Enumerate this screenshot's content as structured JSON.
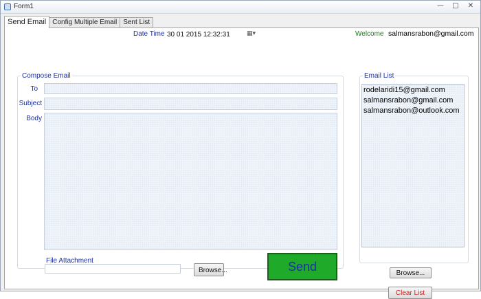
{
  "window": {
    "title": "Form1",
    "controls": [
      "—",
      "□",
      "✕"
    ]
  },
  "tabs": [
    {
      "label": "Send Email",
      "active": true
    },
    {
      "label": "Config Multiple Email",
      "active": false
    },
    {
      "label": "Sent List",
      "active": false
    }
  ],
  "header": {
    "datetime_label": "Date Time",
    "datetime_value": "30 01 2015 12:32:31",
    "datetime_dropdown_glyph": "▦▾",
    "welcome_label": "Welcome",
    "user_email": "salmansrabon@gmail.com"
  },
  "compose": {
    "legend": "Compose Email",
    "to_label": "To",
    "to_value": "",
    "subject_label": "Subject",
    "subject_value": "",
    "body_label": "Body",
    "body_value": "",
    "attachment_label": "File Attachment",
    "attachment_value": "",
    "browse_label": "Browse...",
    "send_label": "Send"
  },
  "email_list": {
    "legend": "Email List",
    "items": [
      "rodelaridi15@gmail.com",
      "salmansrabon@gmail.com",
      "salmansrabon@outlook.com"
    ],
    "browse_label": "Browse...",
    "clear_label": "Clear List"
  },
  "colors": {
    "label_blue": "#1a2fa8",
    "welcome_green": "#1f7a1f",
    "send_green": "#1faa2a",
    "clear_red": "#cc1f1f"
  }
}
